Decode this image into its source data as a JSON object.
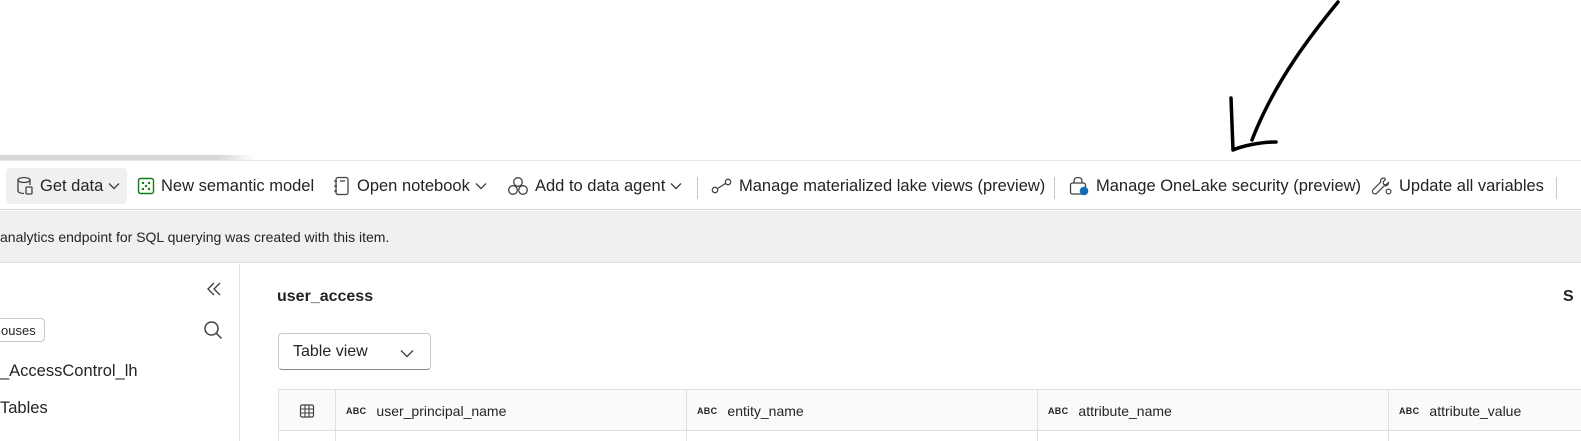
{
  "ribbon": {
    "items": [
      {
        "label": "Get data",
        "icon": "database-icon"
      },
      {
        "label": "New semantic model",
        "icon": "semantic-model-icon"
      },
      {
        "label": "Open notebook",
        "icon": "notebook-icon"
      },
      {
        "label": "Add to data agent",
        "icon": "data-agent-icon"
      },
      {
        "label": "Manage materialized lake views (preview)",
        "icon": "lineage-icon"
      },
      {
        "label": "Manage OneLake security (preview)",
        "icon": "security-lock-icon"
      },
      {
        "label": "Update all variables",
        "icon": "wrench-icon"
      }
    ]
  },
  "infobar": {
    "message": "analytics endpoint for SQL querying was created with this item."
  },
  "explorer": {
    "filter_chip": "ouses",
    "items": [
      {
        "label": "_AccessControl_lh"
      },
      {
        "label": "Tables"
      }
    ]
  },
  "main": {
    "table_title": "user_access",
    "right_cut_text": "S",
    "view_select": "Table view",
    "columns": [
      {
        "type": "ABC",
        "name": "user_principal_name"
      },
      {
        "type": "ABC",
        "name": "entity_name"
      },
      {
        "type": "ABC",
        "name": "attribute_name"
      },
      {
        "type": "ABC",
        "name": "attribute_value"
      }
    ]
  },
  "colors": {
    "accent_green": "#107c10",
    "security_blue": "#0f6cbd",
    "infobar_bg": "#f0f0f0"
  }
}
